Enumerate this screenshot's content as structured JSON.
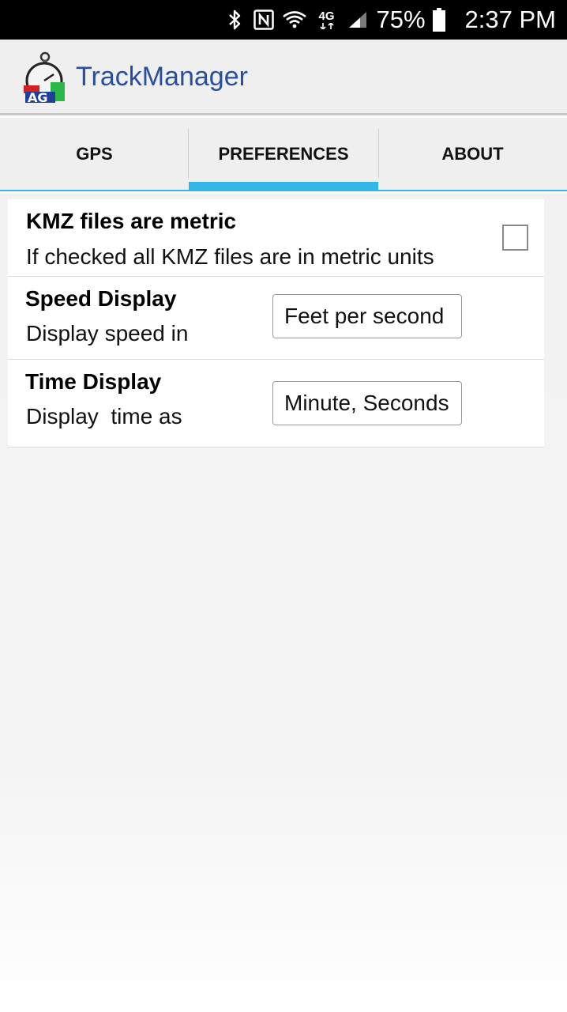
{
  "status_bar": {
    "icons": [
      "bluetooth-icon",
      "nfc-icon",
      "wifi-icon",
      "lte-icon",
      "signal-icon",
      "battery-icon"
    ],
    "network_label": "4G",
    "battery_percent": "75%",
    "time": "2:37 PM"
  },
  "app_bar": {
    "title": "TrackManager",
    "logo_text": "AG",
    "logo_icon": "stopwatch-logo-icon"
  },
  "tabs": [
    {
      "label": "GPS",
      "selected": false
    },
    {
      "label": "PREFERENCES",
      "selected": true
    },
    {
      "label": "ABOUT",
      "selected": false
    }
  ],
  "colors": {
    "accent": "#33b5e5",
    "title": "#2a4f9a",
    "status_bar": "#000000"
  },
  "preferences": {
    "kmz": {
      "title": "KMZ files are metric",
      "summary": "If checked all KMZ files are in metric units",
      "checked": false
    },
    "speed": {
      "title": "Speed Display",
      "summary": "Display speed in",
      "value": "Feet per second"
    },
    "time": {
      "title": "Time Display",
      "summary": "Display  time as",
      "value": "Minute, Seconds"
    }
  }
}
